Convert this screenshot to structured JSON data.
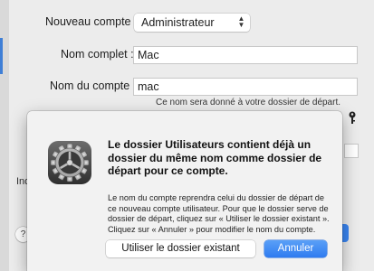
{
  "form": {
    "account_type_label": "Nouveau compte :",
    "account_type_value": "Administrateur",
    "full_name_label": "Nom complet :",
    "full_name_value": "Mac",
    "account_name_label": "Nom du compte :",
    "account_name_value": "mac",
    "account_name_hint": "Ce nom sera donné à votre dossier de départ.",
    "partial_label": "Ind"
  },
  "alert": {
    "icon": "gear-icon",
    "title": "Le dossier Utilisateurs contient déjà un dossier du même nom comme dossier de départ pour ce compte.",
    "body": "Le nom du compte reprendra celui du dossier de départ de ce nouveau compte utilisateur. Pour que le dossier serve de dossier de départ, cliquez sur « Utiliser le dossier existant ». Cliquez sur « Annuler » pour modifier le nom du compte.",
    "use_existing_label": "Utiliser le dossier existant",
    "cancel_label": "Annuler"
  },
  "icons": {
    "key": "key-icon",
    "help": "help-icon",
    "chevron": "up-down-chevron-icon"
  },
  "colors": {
    "accent": "#2f7bf0",
    "dialog_bg": "#f2f2f2"
  }
}
